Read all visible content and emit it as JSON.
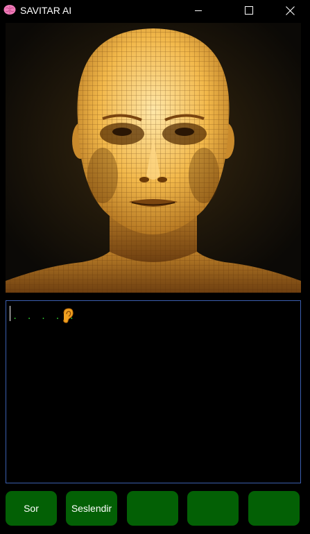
{
  "window": {
    "title": "SAVITAR AI",
    "icon": "brain-icon",
    "controls": [
      "minimize-icon",
      "maximize-icon",
      "close-icon"
    ]
  },
  "portrait": {
    "icon": "wireframe-face-image"
  },
  "output": {
    "text": ". . . . .",
    "status_icon": "ear-icon"
  },
  "buttons": [
    {
      "label": "Sor"
    },
    {
      "label": "Seslendir"
    },
    {
      "label": ""
    },
    {
      "label": ""
    },
    {
      "label": ""
    }
  ],
  "colors": {
    "background": "#000000",
    "button_green": "#036005",
    "output_border": "#3c5fb0",
    "dots_green": "#2fbf2f",
    "face_gold": "#f2b84a"
  }
}
